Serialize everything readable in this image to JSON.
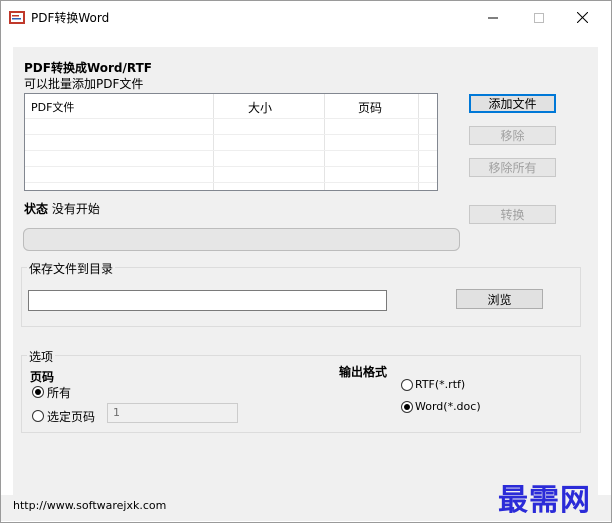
{
  "window": {
    "title": "PDF转换Word"
  },
  "header": {
    "heading": "PDF转换成Word/RTF",
    "subheading": "可以批量添加PDF文件"
  },
  "file_list": {
    "columns": [
      "PDF文件",
      "大小",
      "页码"
    ],
    "rows": []
  },
  "buttons": {
    "add_file": "添加文件",
    "remove": "移除",
    "remove_all": "移除所有",
    "convert": "转换",
    "browse": "浏览"
  },
  "status": {
    "label": "状态",
    "value": "没有开始",
    "progress": 0
  },
  "save_dir": {
    "group_label": "保存文件到目录",
    "value": ""
  },
  "options": {
    "group_label": "选项",
    "pages_heading": "页码",
    "all_label": "所有",
    "selected_label": "选定页码",
    "page_input_value": "1",
    "output_heading": "输出格式",
    "rtf_label": "RTF(*.rtf)",
    "word_label": "Word(*.doc)",
    "selected_pages": "all",
    "selected_format": "word"
  },
  "statusbar": {
    "url": "http://www.softwarejxk.com"
  },
  "watermark": {
    "text": "最需网"
  }
}
